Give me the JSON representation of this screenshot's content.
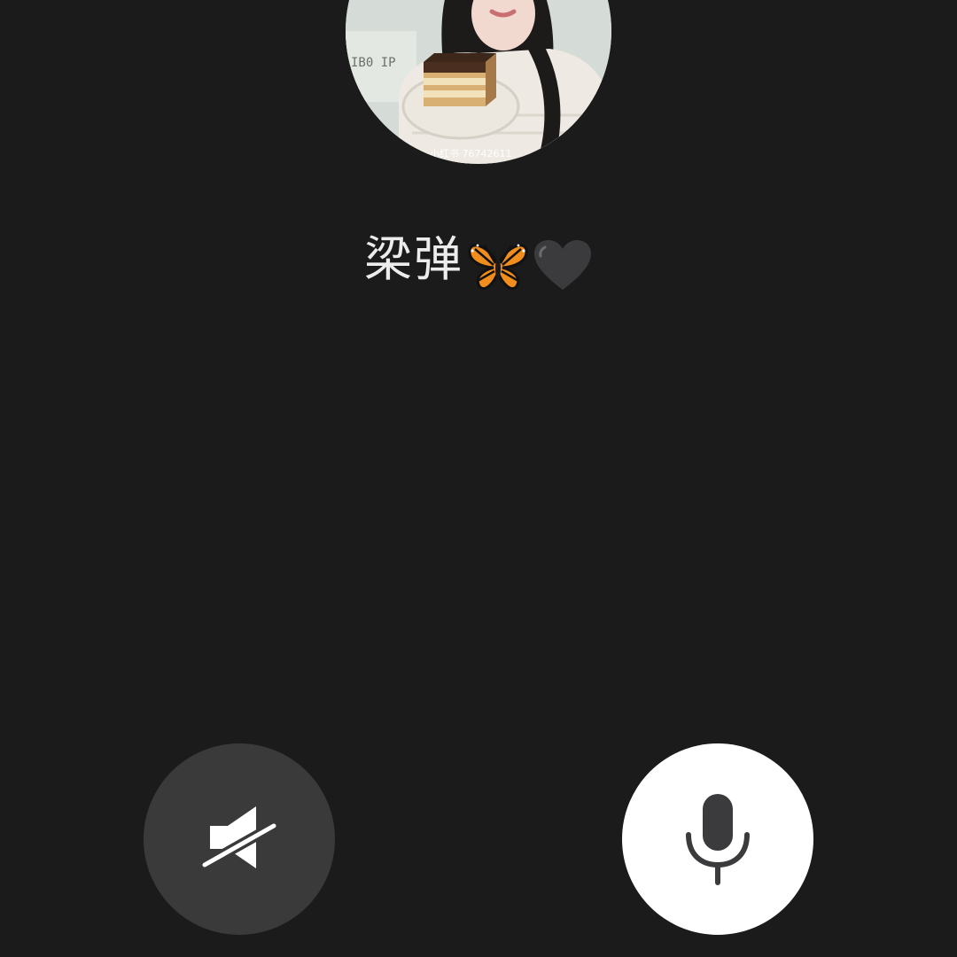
{
  "call": {
    "caller_name": "梁弹",
    "name_emojis": [
      "butterfly-emoji",
      "black-heart-emoji"
    ],
    "avatar_watermark": "小红书 76742611"
  },
  "controls": {
    "speaker": {
      "icon": "speaker-muted-icon",
      "state": "muted"
    },
    "mic": {
      "icon": "microphone-icon",
      "state": "on"
    }
  },
  "colors": {
    "background": "#1b1b1c",
    "speaker_button": "#3a3a3b",
    "mic_button": "#ffffff",
    "name_text": "#ececec"
  }
}
